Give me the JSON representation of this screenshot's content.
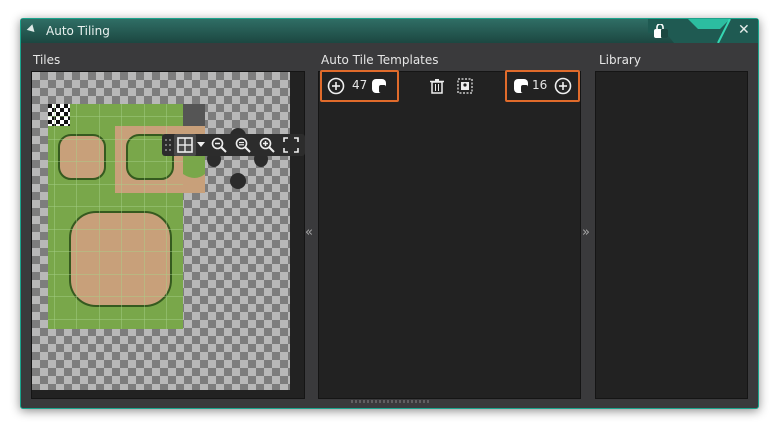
{
  "window": {
    "title": "Auto Tiling",
    "accent_color": "#1aa38c",
    "icons": {
      "collapse": "triangle-collapse-icon",
      "lock": "lock-icon",
      "close": "close-icon"
    },
    "close_glyph": "✕"
  },
  "tiles_panel": {
    "label": "Tiles",
    "toolbar": {
      "icons": [
        "grip-icon",
        "grid-toggle-icon",
        "dropdown-icon",
        "zoom-out-icon",
        "zoom-reset-icon",
        "zoom-in-icon",
        "fit-screen-icon"
      ]
    }
  },
  "templates_panel": {
    "label": "Auto Tile Templates",
    "left_group": {
      "icons": [
        "add-icon",
        "lock-icon"
      ],
      "count": "47"
    },
    "right_group": {
      "icons": [
        "lock-icon",
        "add-icon"
      ],
      "count": "16"
    },
    "middle_icons": [
      "delete-icon",
      "image-template-icon"
    ],
    "highlight_color": "#e06b2b"
  },
  "library_panel": {
    "label": "Library"
  },
  "collapse_arrows": {
    "left": "«",
    "right": "»"
  }
}
